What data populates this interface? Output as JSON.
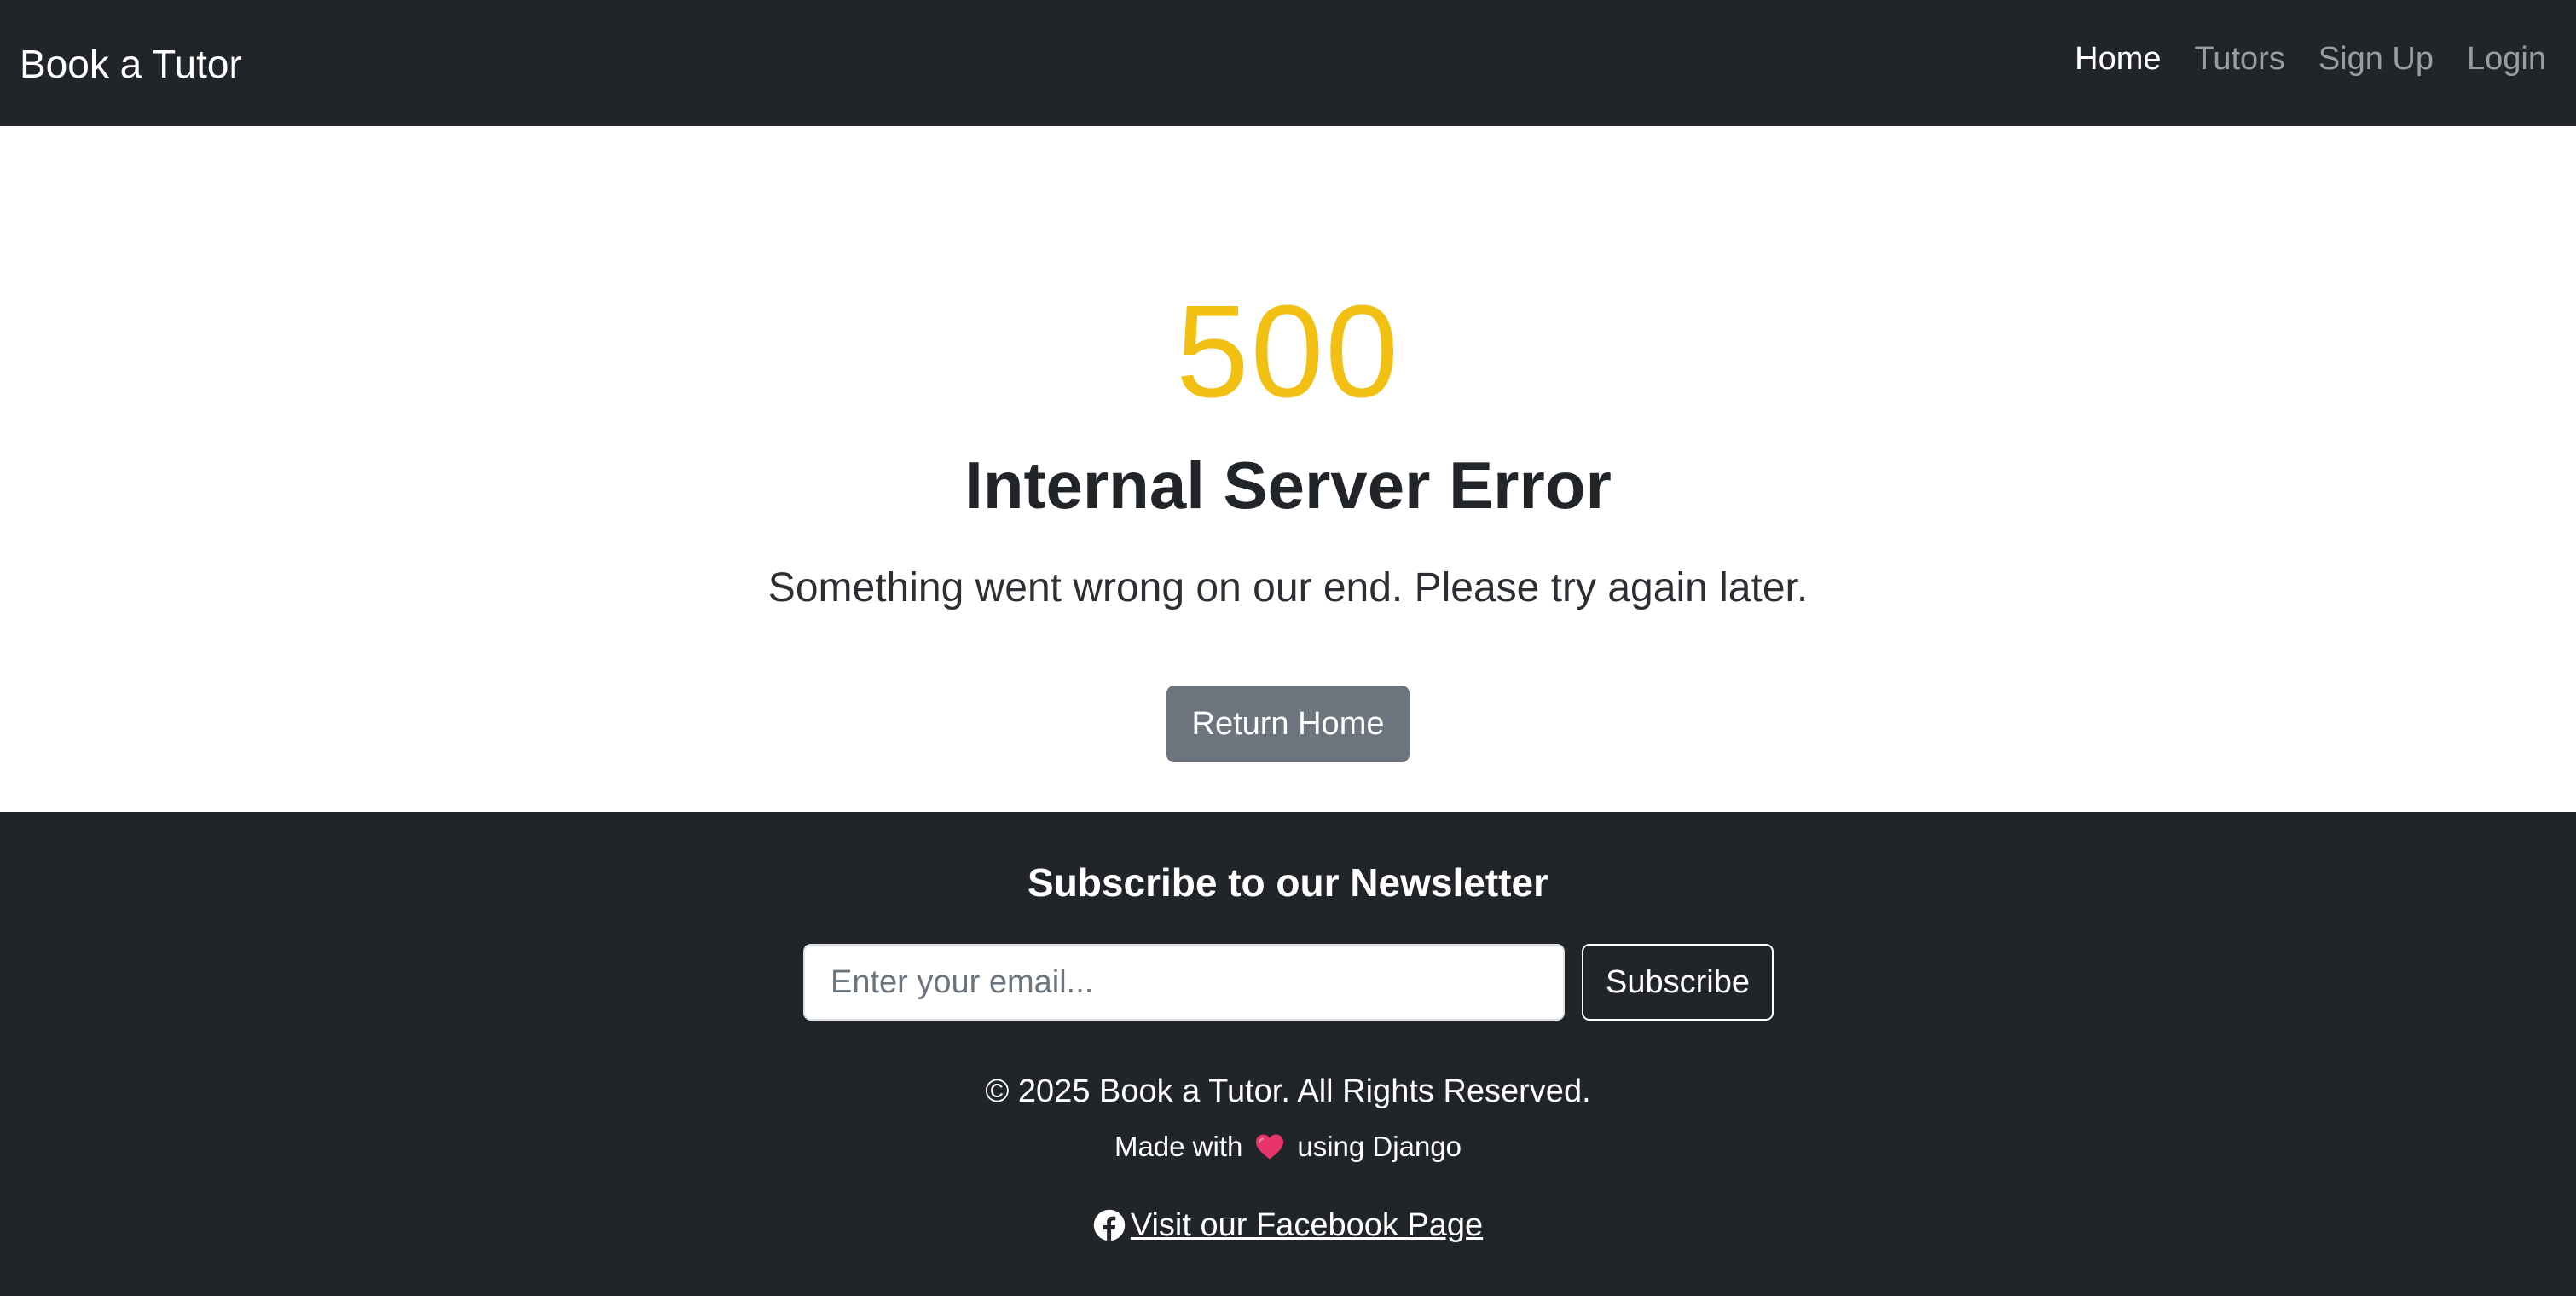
{
  "navbar": {
    "brand": "Book a Tutor",
    "links": [
      {
        "label": "Home",
        "active": true
      },
      {
        "label": "Tutors",
        "active": false
      },
      {
        "label": "Sign Up",
        "active": false
      },
      {
        "label": "Login",
        "active": false
      }
    ]
  },
  "error": {
    "code": "500",
    "title": "Internal Server Error",
    "message": "Something went wrong on our end. Please try again later.",
    "button_label": "Return Home"
  },
  "footer": {
    "newsletter_title": "Subscribe to our Newsletter",
    "email_placeholder": "Enter your email...",
    "email_value": "",
    "subscribe_label": "Subscribe",
    "copyright": "© 2025 Book a Tutor. All Rights Reserved.",
    "made_with_prefix": "Made with",
    "made_with_suffix": "using Django",
    "heart_icon": "heart-icon",
    "facebook_icon": "facebook-icon",
    "facebook_link": "Visit our Facebook Page"
  },
  "colors": {
    "navbar_bg": "#212529",
    "accent_warning": "#f2c012",
    "button_secondary": "#6c757d",
    "heart": "#e8336b"
  }
}
